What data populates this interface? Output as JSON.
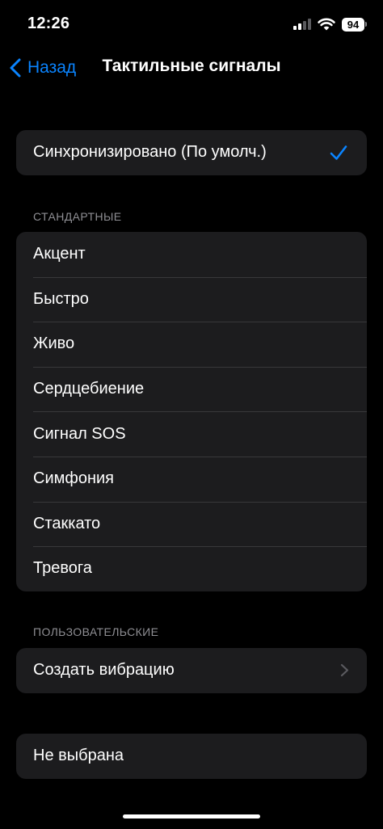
{
  "status_bar": {
    "time": "12:26",
    "battery": "94"
  },
  "nav": {
    "back_label": "Назад",
    "title": "Тактильные сигналы"
  },
  "synced": {
    "label": "Синхронизировано (По умолч.)",
    "selected": true
  },
  "standard": {
    "header": "СТАНДАРТНЫЕ",
    "items": [
      {
        "label": "Акцент"
      },
      {
        "label": "Быстро"
      },
      {
        "label": "Живо"
      },
      {
        "label": "Сердцебиение"
      },
      {
        "label": "Сигнал SOS"
      },
      {
        "label": "Симфония"
      },
      {
        "label": "Стаккато"
      },
      {
        "label": "Тревога"
      }
    ]
  },
  "custom": {
    "header": "ПОЛЬЗОВАТЕЛЬСКИЕ",
    "create_label": "Создать вибрацию"
  },
  "none": {
    "label": "Не выбрана"
  },
  "colors": {
    "accent": "#0a84ff",
    "background": "#000000",
    "cell": "#1c1c1e",
    "separator": "#38383a",
    "secondary_text": "#8e8e93"
  }
}
